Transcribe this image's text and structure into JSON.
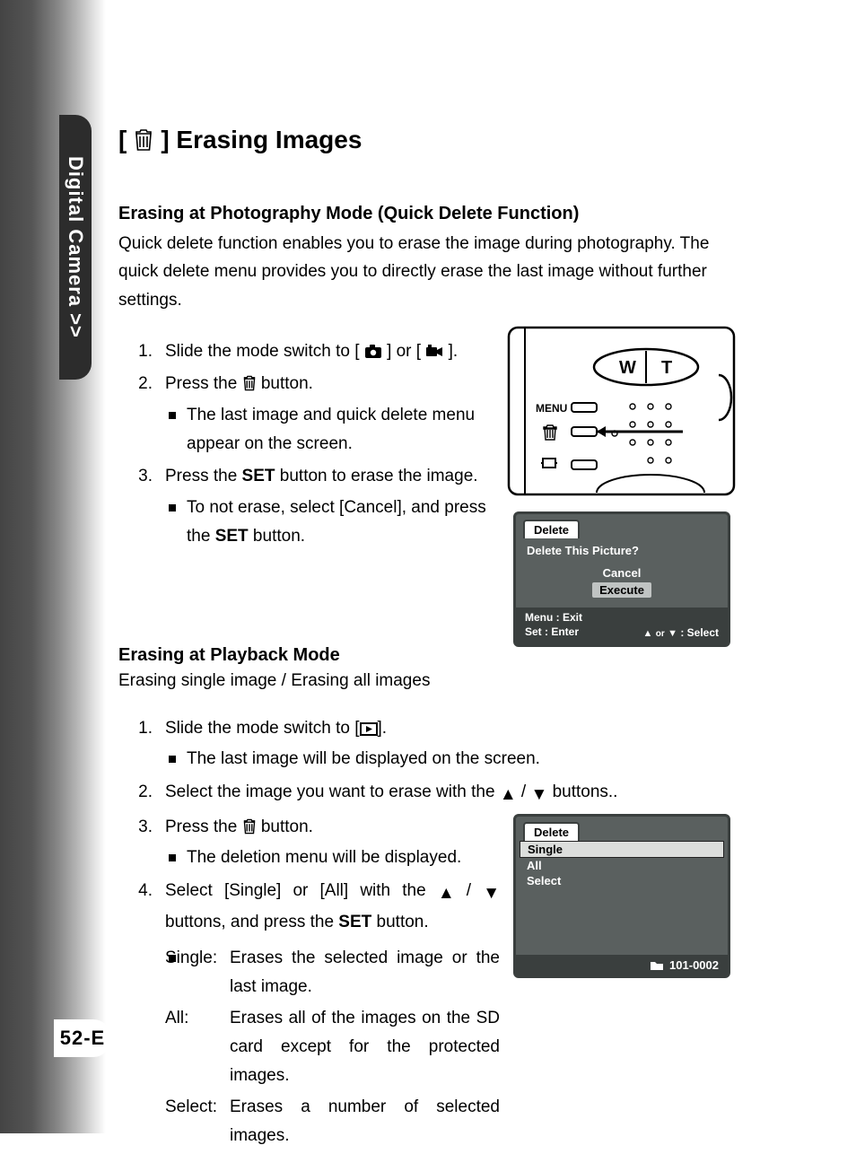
{
  "sidebar": {
    "label": "Digital Camera >>"
  },
  "page_number": "52-E",
  "h1": {
    "prefix": "[",
    "suffix": "] Erasing Images"
  },
  "section1": {
    "heading": "Erasing at Photography Mode (Quick Delete Function)",
    "intro": "Quick delete function enables you to erase the image during photography. The quick delete menu provides you to directly erase the last image without further settings.",
    "step1a": "Slide the mode switch to [",
    "step1b": "] or [",
    "step1c": "].",
    "step2a": "Press the ",
    "step2b": " button.",
    "step2_bullet": "The last image and quick delete menu appear on the screen.",
    "step3a": "Press the ",
    "step3_set": "SET",
    "step3b": " button to erase the image.",
    "step3_bullet_a": "To not erase, select [Cancel], and press the ",
    "step3_bullet_set": "SET",
    "step3_bullet_b": " button."
  },
  "screen1": {
    "tab": "Delete",
    "prompt": "Delete This Picture?",
    "opt1": "Cancel",
    "opt2": "Execute",
    "footer_left1": "Menu : Exit",
    "footer_left2": "Set : Enter",
    "footer_right": "▲ or ▼ : Select"
  },
  "section2": {
    "heading": "Erasing at Playback Mode",
    "intro": "Erasing single image / Erasing all images",
    "s1a": "Slide the mode switch to [",
    "s1b": "].",
    "s1_bullet": "The last image will be displayed on the screen.",
    "s2a": "Select the image you want to erase with the ",
    "s2b": " buttons..",
    "s3a": "Press the ",
    "s3b": " button.",
    "s3_bullet": "The deletion menu will be displayed.",
    "s4a": "Select [Single] or [All] with the ",
    "s4b": " buttons, and press the ",
    "s4_set": "SET",
    "s4c": " button.",
    "def_single_term": "Single:",
    "def_single": "Erases the selected image or the last image.",
    "def_all_term": "All:",
    "def_all": "Erases all of the images on the SD card except for the protected images.",
    "def_select_term": "Select:",
    "def_select": "Erases a number of selected images."
  },
  "screen2": {
    "tab": "Delete",
    "items": [
      "Single",
      "All",
      "Select"
    ],
    "folder": "101-0002"
  },
  "camera": {
    "label_menu": "MENU",
    "label_w": "W",
    "label_t": "T"
  }
}
